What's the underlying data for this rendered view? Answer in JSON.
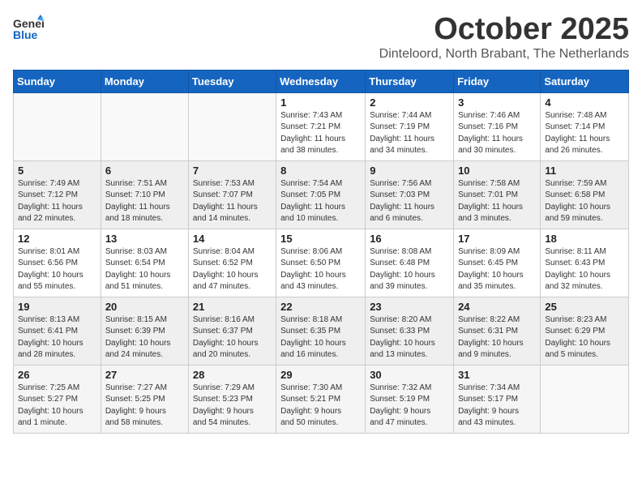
{
  "header": {
    "logo_general": "General",
    "logo_blue": "Blue",
    "month": "October 2025",
    "location": "Dinteloord, North Brabant, The Netherlands"
  },
  "weekdays": [
    "Sunday",
    "Monday",
    "Tuesday",
    "Wednesday",
    "Thursday",
    "Friday",
    "Saturday"
  ],
  "weeks": [
    [
      {
        "day": "",
        "info": ""
      },
      {
        "day": "",
        "info": ""
      },
      {
        "day": "",
        "info": ""
      },
      {
        "day": "1",
        "info": "Sunrise: 7:43 AM\nSunset: 7:21 PM\nDaylight: 11 hours\nand 38 minutes."
      },
      {
        "day": "2",
        "info": "Sunrise: 7:44 AM\nSunset: 7:19 PM\nDaylight: 11 hours\nand 34 minutes."
      },
      {
        "day": "3",
        "info": "Sunrise: 7:46 AM\nSunset: 7:16 PM\nDaylight: 11 hours\nand 30 minutes."
      },
      {
        "day": "4",
        "info": "Sunrise: 7:48 AM\nSunset: 7:14 PM\nDaylight: 11 hours\nand 26 minutes."
      }
    ],
    [
      {
        "day": "5",
        "info": "Sunrise: 7:49 AM\nSunset: 7:12 PM\nDaylight: 11 hours\nand 22 minutes."
      },
      {
        "day": "6",
        "info": "Sunrise: 7:51 AM\nSunset: 7:10 PM\nDaylight: 11 hours\nand 18 minutes."
      },
      {
        "day": "7",
        "info": "Sunrise: 7:53 AM\nSunset: 7:07 PM\nDaylight: 11 hours\nand 14 minutes."
      },
      {
        "day": "8",
        "info": "Sunrise: 7:54 AM\nSunset: 7:05 PM\nDaylight: 11 hours\nand 10 minutes."
      },
      {
        "day": "9",
        "info": "Sunrise: 7:56 AM\nSunset: 7:03 PM\nDaylight: 11 hours\nand 6 minutes."
      },
      {
        "day": "10",
        "info": "Sunrise: 7:58 AM\nSunset: 7:01 PM\nDaylight: 11 hours\nand 3 minutes."
      },
      {
        "day": "11",
        "info": "Sunrise: 7:59 AM\nSunset: 6:58 PM\nDaylight: 10 hours\nand 59 minutes."
      }
    ],
    [
      {
        "day": "12",
        "info": "Sunrise: 8:01 AM\nSunset: 6:56 PM\nDaylight: 10 hours\nand 55 minutes."
      },
      {
        "day": "13",
        "info": "Sunrise: 8:03 AM\nSunset: 6:54 PM\nDaylight: 10 hours\nand 51 minutes."
      },
      {
        "day": "14",
        "info": "Sunrise: 8:04 AM\nSunset: 6:52 PM\nDaylight: 10 hours\nand 47 minutes."
      },
      {
        "day": "15",
        "info": "Sunrise: 8:06 AM\nSunset: 6:50 PM\nDaylight: 10 hours\nand 43 minutes."
      },
      {
        "day": "16",
        "info": "Sunrise: 8:08 AM\nSunset: 6:48 PM\nDaylight: 10 hours\nand 39 minutes."
      },
      {
        "day": "17",
        "info": "Sunrise: 8:09 AM\nSunset: 6:45 PM\nDaylight: 10 hours\nand 35 minutes."
      },
      {
        "day": "18",
        "info": "Sunrise: 8:11 AM\nSunset: 6:43 PM\nDaylight: 10 hours\nand 32 minutes."
      }
    ],
    [
      {
        "day": "19",
        "info": "Sunrise: 8:13 AM\nSunset: 6:41 PM\nDaylight: 10 hours\nand 28 minutes."
      },
      {
        "day": "20",
        "info": "Sunrise: 8:15 AM\nSunset: 6:39 PM\nDaylight: 10 hours\nand 24 minutes."
      },
      {
        "day": "21",
        "info": "Sunrise: 8:16 AM\nSunset: 6:37 PM\nDaylight: 10 hours\nand 20 minutes."
      },
      {
        "day": "22",
        "info": "Sunrise: 8:18 AM\nSunset: 6:35 PM\nDaylight: 10 hours\nand 16 minutes."
      },
      {
        "day": "23",
        "info": "Sunrise: 8:20 AM\nSunset: 6:33 PM\nDaylight: 10 hours\nand 13 minutes."
      },
      {
        "day": "24",
        "info": "Sunrise: 8:22 AM\nSunset: 6:31 PM\nDaylight: 10 hours\nand 9 minutes."
      },
      {
        "day": "25",
        "info": "Sunrise: 8:23 AM\nSunset: 6:29 PM\nDaylight: 10 hours\nand 5 minutes."
      }
    ],
    [
      {
        "day": "26",
        "info": "Sunrise: 7:25 AM\nSunset: 5:27 PM\nDaylight: 10 hours\nand 1 minute."
      },
      {
        "day": "27",
        "info": "Sunrise: 7:27 AM\nSunset: 5:25 PM\nDaylight: 9 hours\nand 58 minutes."
      },
      {
        "day": "28",
        "info": "Sunrise: 7:29 AM\nSunset: 5:23 PM\nDaylight: 9 hours\nand 54 minutes."
      },
      {
        "day": "29",
        "info": "Sunrise: 7:30 AM\nSunset: 5:21 PM\nDaylight: 9 hours\nand 50 minutes."
      },
      {
        "day": "30",
        "info": "Sunrise: 7:32 AM\nSunset: 5:19 PM\nDaylight: 9 hours\nand 47 minutes."
      },
      {
        "day": "31",
        "info": "Sunrise: 7:34 AM\nSunset: 5:17 PM\nDaylight: 9 hours\nand 43 minutes."
      },
      {
        "day": "",
        "info": ""
      }
    ]
  ]
}
